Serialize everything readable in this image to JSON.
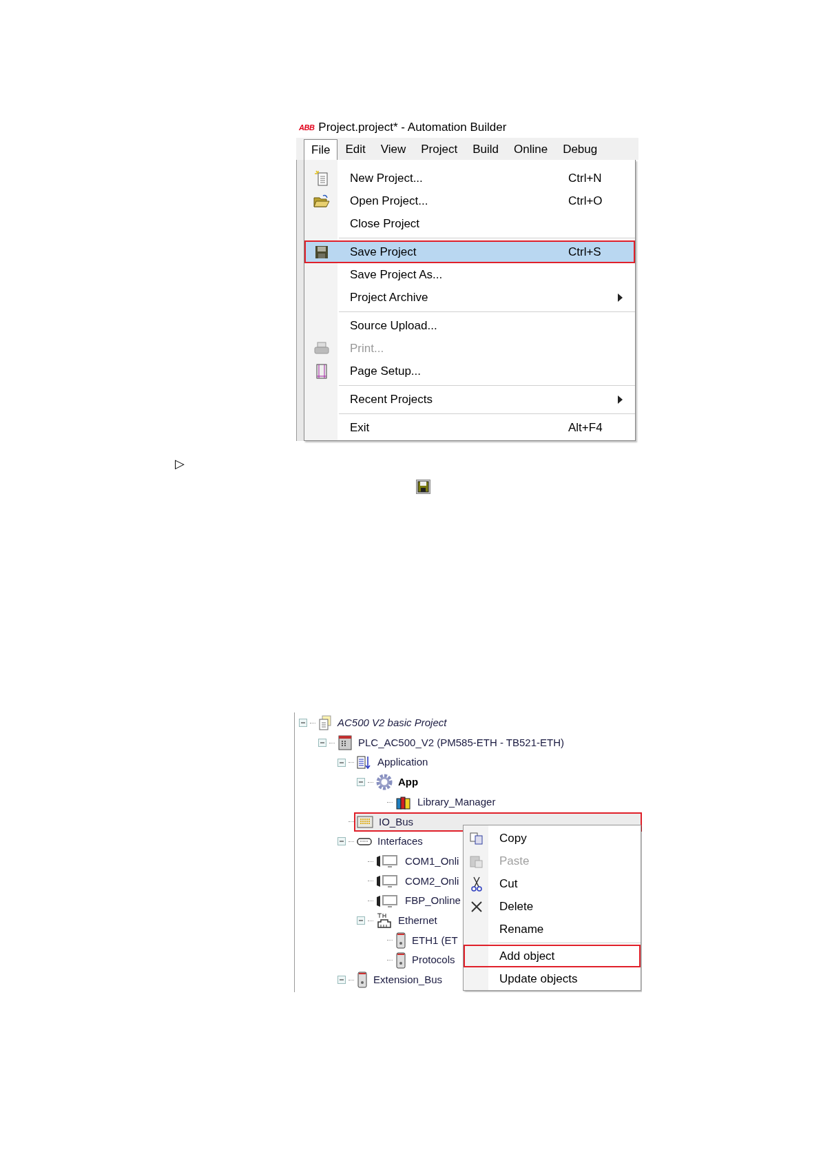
{
  "window": {
    "logo": "ABB",
    "title": "Project.project* - Automation Builder"
  },
  "menu_bar": [
    {
      "label": "File",
      "selected": true
    },
    {
      "label": "Edit",
      "selected": false
    },
    {
      "label": "View",
      "selected": false
    },
    {
      "label": "Project",
      "selected": false
    },
    {
      "label": "Build",
      "selected": false
    },
    {
      "label": "Online",
      "selected": false
    },
    {
      "label": "Debug",
      "selected": false
    }
  ],
  "file_menu": [
    {
      "kind": "item",
      "label": "New Project...",
      "shortcut": "Ctrl+N",
      "selected": false,
      "marked": false,
      "disabled": false
    },
    {
      "kind": "item",
      "label": "Open Project...",
      "shortcut": "Ctrl+O",
      "selected": false,
      "marked": false,
      "disabled": false
    },
    {
      "kind": "item",
      "label": "Close Project",
      "selected": false,
      "marked": false,
      "disabled": false
    },
    {
      "kind": "separator"
    },
    {
      "kind": "item",
      "label": "Save Project",
      "shortcut": "Ctrl+S",
      "selected": true,
      "marked": true,
      "disabled": false
    },
    {
      "kind": "item",
      "label": "Save Project As...",
      "selected": false,
      "marked": false,
      "disabled": false
    },
    {
      "kind": "submenu",
      "label": "Project Archive",
      "selected": false,
      "marked": false,
      "disabled": false
    },
    {
      "kind": "separator"
    },
    {
      "kind": "item",
      "label": "Source Upload...",
      "selected": false,
      "marked": false,
      "disabled": false
    },
    {
      "kind": "item",
      "label": "Print...",
      "selected": false,
      "marked": false,
      "disabled": true
    },
    {
      "kind": "item",
      "label": "Page Setup...",
      "selected": false,
      "marked": false,
      "disabled": false
    },
    {
      "kind": "separator"
    },
    {
      "kind": "submenu",
      "label": "Recent Projects",
      "selected": false,
      "marked": false,
      "disabled": false
    },
    {
      "kind": "separator"
    },
    {
      "kind": "item",
      "label": "Exit",
      "shortcut": "Alt+F4",
      "selected": false,
      "marked": false,
      "disabled": false
    }
  ],
  "bullet": "▷",
  "tree": [
    {
      "label": "AC500 V2 basic Project",
      "expanded": true,
      "selected": false,
      "marked": false,
      "children": [
        {
          "label": "PLC_AC500_V2 (PM585-ETH - TB521-ETH)",
          "expanded": true,
          "selected": false,
          "marked": false,
          "children": [
            {
              "label": "Application",
              "expanded": true,
              "selected": false,
              "marked": false,
              "children": [
                {
                  "label": "App",
                  "expanded": true,
                  "selected": false,
                  "marked": false,
                  "children": [
                    {
                      "label": "Library_Manager",
                      "selected": false,
                      "marked": false
                    }
                  ]
                }
              ]
            },
            {
              "label": "IO_Bus",
              "selected": true,
              "marked": true
            },
            {
              "label": "Interfaces",
              "expanded": true,
              "selected": false,
              "marked": false,
              "children": [
                {
                  "label": "COM1_Onli",
                  "selected": false,
                  "marked": false
                },
                {
                  "label": "COM2_Onli",
                  "selected": false,
                  "marked": false
                },
                {
                  "label": "FBP_Online",
                  "selected": false,
                  "marked": false
                },
                {
                  "label": "Ethernet",
                  "expanded": true,
                  "selected": false,
                  "marked": false,
                  "children": [
                    {
                      "label": "ETH1 (ET",
                      "selected": false,
                      "marked": false
                    },
                    {
                      "label": "Protocols",
                      "selected": false,
                      "marked": false
                    }
                  ]
                }
              ]
            },
            {
              "label": "Extension_Bus",
              "expanded": true,
              "selected": false,
              "marked": false
            }
          ]
        }
      ]
    }
  ],
  "context_menu": [
    {
      "kind": "item",
      "label": "Copy",
      "disabled": false,
      "marked": false
    },
    {
      "kind": "item",
      "label": "Paste",
      "disabled": true,
      "marked": false
    },
    {
      "kind": "item",
      "label": "Cut",
      "disabled": false,
      "marked": false
    },
    {
      "kind": "item",
      "label": "Delete",
      "disabled": false,
      "marked": false
    },
    {
      "kind": "item",
      "label": "Rename",
      "disabled": false,
      "marked": false
    },
    {
      "kind": "separator"
    },
    {
      "kind": "item",
      "label": "Add object",
      "disabled": false,
      "marked": true
    },
    {
      "kind": "item",
      "label": "Update objects",
      "disabled": false,
      "marked": false
    }
  ]
}
